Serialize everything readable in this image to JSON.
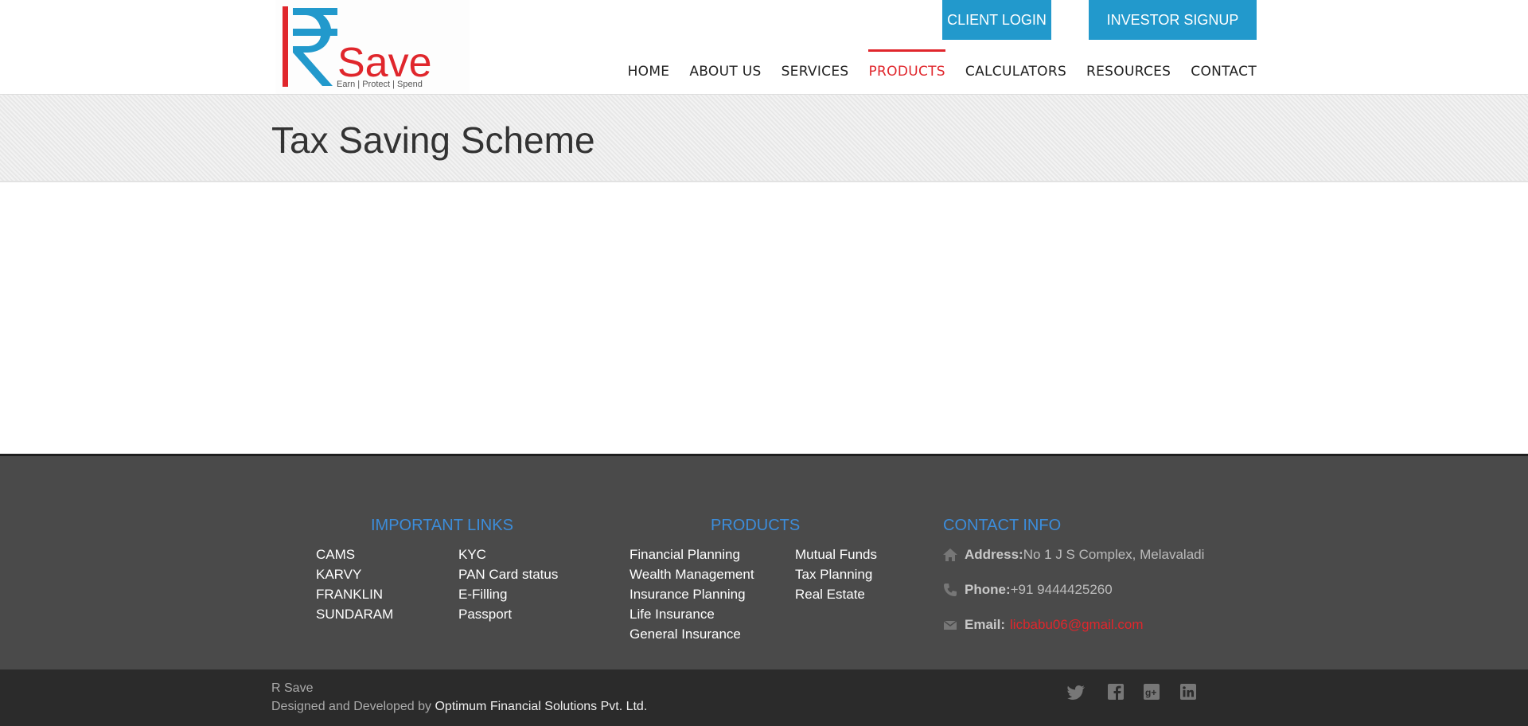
{
  "header": {
    "logo": {
      "brand": "Save",
      "tagline": "Earn | Protect | Spend",
      "colors": {
        "blue": "#2299cc",
        "red": "#e0262c"
      }
    },
    "client_login": "CLIENT LOGIN",
    "investor_signup": "INVESTOR SIGNUP",
    "nav": [
      {
        "label": "HOME"
      },
      {
        "label": "ABOUT US"
      },
      {
        "label": "SERVICES"
      },
      {
        "label": "PRODUCTS",
        "active": true
      },
      {
        "label": "CALCULATORS"
      },
      {
        "label": "RESOURCES"
      },
      {
        "label": "CONTACT"
      }
    ]
  },
  "page": {
    "title": "Tax Saving Scheme"
  },
  "footer": {
    "important_links": {
      "heading": "IMPORTANT LINKS",
      "col1": [
        "CAMS",
        "KARVY",
        "FRANKLIN",
        "SUNDARAM"
      ],
      "col2": [
        "KYC",
        "PAN Card status",
        "E-Filling",
        "Passport"
      ]
    },
    "products": {
      "heading": "PRODUCTS",
      "col1": [
        "Financial Planning",
        "Wealth Management",
        "Insurance Planning",
        "Life Insurance",
        "General Insurance"
      ],
      "col2": [
        "Mutual Funds",
        "Tax Planning",
        "Real Estate"
      ]
    },
    "contact": {
      "heading": "CONTACT INFO",
      "address_label": "Address:",
      "address": "No 1 J S Complex, Melavaladi",
      "phone_label": "Phone:",
      "phone": "+91 9444425260",
      "email_label": "Email:",
      "email": "licbabu06@gmail.com"
    }
  },
  "bottom": {
    "site_name": "R Save",
    "credit_prefix": "Designed and Developed by ",
    "company": "Optimum Financial Solutions Pvt. Ltd.",
    "social_icons": [
      "twitter-icon",
      "facebook-icon",
      "google-plus-icon",
      "linkedin-icon"
    ]
  }
}
